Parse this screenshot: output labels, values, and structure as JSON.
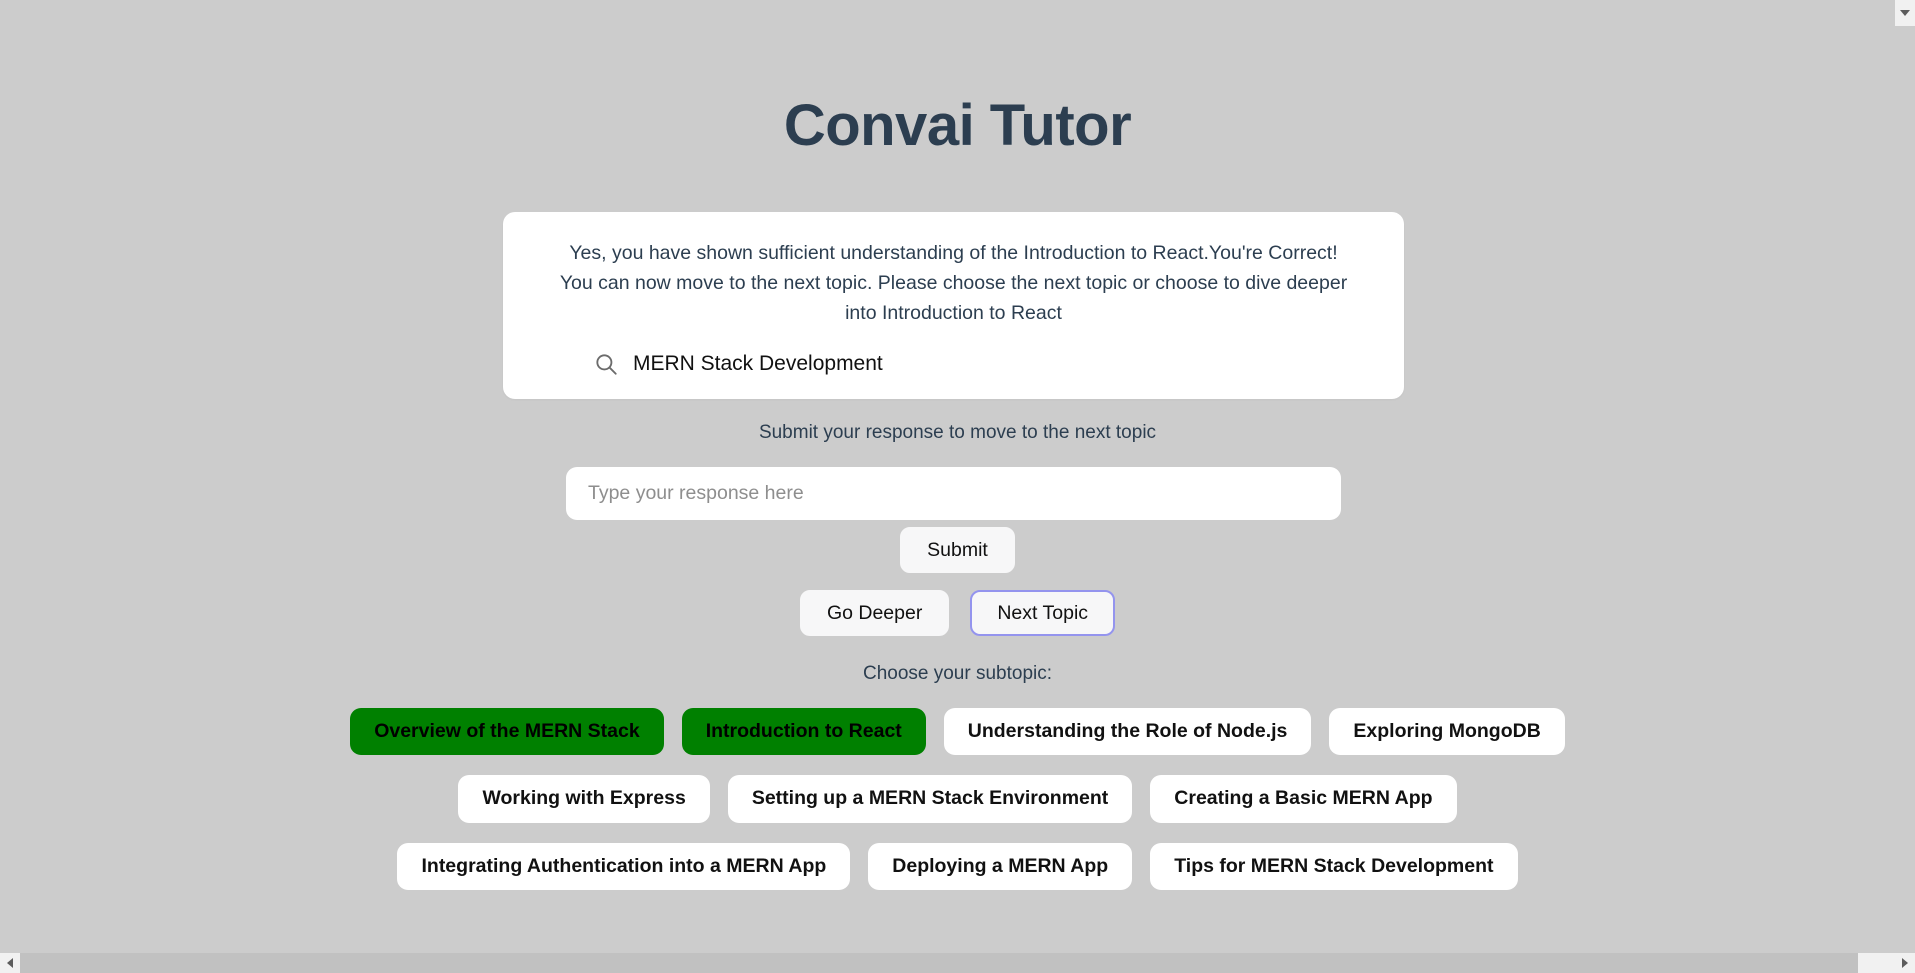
{
  "app": {
    "title": "Convai Tutor",
    "background_color": "#cccccc",
    "title_color": "#2c3e50"
  },
  "feedback_card": {
    "message": "Yes, you have shown sufficient understanding of the Introduction to React.You're Correct! You can now move to the next topic. Please choose the next topic or choose to dive deeper into Introduction to React",
    "search": {
      "icon": "search-icon",
      "value": "MERN Stack Development"
    }
  },
  "response": {
    "prompt_label": "Submit your response to move to the next topic",
    "placeholder": "Type your response here",
    "value": "",
    "submit_label": "Submit"
  },
  "navigation": {
    "go_deeper_label": "Go Deeper",
    "next_topic_label": "Next Topic",
    "focused_button": "Next Topic",
    "focus_border_color": "#9494ee"
  },
  "subtopics": {
    "label": "Choose your subtopic:",
    "selected_color": "#008000",
    "items": [
      {
        "label": "Overview of the MERN Stack",
        "selected": true
      },
      {
        "label": "Introduction to React",
        "selected": true
      },
      {
        "label": "Understanding the Role of Node.js",
        "selected": false
      },
      {
        "label": "Exploring MongoDB",
        "selected": false
      },
      {
        "label": "Working with Express",
        "selected": false
      },
      {
        "label": "Setting up a MERN Stack Environment",
        "selected": false
      },
      {
        "label": "Creating a Basic MERN App",
        "selected": false
      },
      {
        "label": "Integrating Authentication into a MERN App",
        "selected": false
      },
      {
        "label": "Deploying a MERN App",
        "selected": false
      },
      {
        "label": "Tips for MERN Stack Development",
        "selected": false
      }
    ]
  }
}
